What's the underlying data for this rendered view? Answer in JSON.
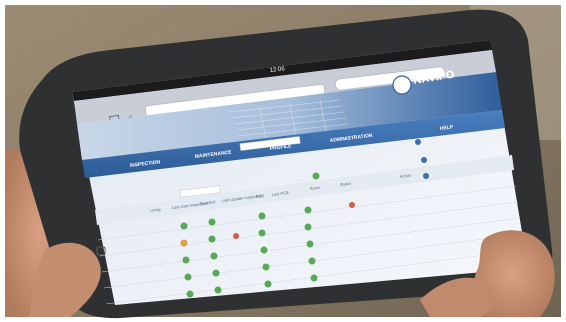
{
  "browser": {
    "status_time": "12:06",
    "carrier": "iPad",
    "url_placeholder": ""
  },
  "app": {
    "brand": "NAVIPO",
    "nav_tabs": [
      "INSPECTION",
      "MAINTENANCE",
      "PROFILE",
      "ADMINISTRATION",
      "HELP"
    ],
    "table_headers": [
      "Lining",
      "Last Date Inspection",
      "Satisfied",
      "Last Update Inspection",
      "PCB",
      "Last PCB",
      "Rows",
      "Status",
      "Action"
    ]
  },
  "colors": {
    "wall": "#8a7b66",
    "tablet_frame": "#3a3b3d",
    "nav_bar": "#3b6fae",
    "status_ok": "#58a858",
    "status_warn": "#e0a040",
    "screen_bg": "#eef2f7"
  },
  "icons": [
    "back-arrow-icon",
    "forward-arrow-icon",
    "bookmark-icon",
    "add-icon",
    "logo-globe-icon",
    "check-status-icon",
    "warning-status-icon",
    "home-button-icon"
  ]
}
